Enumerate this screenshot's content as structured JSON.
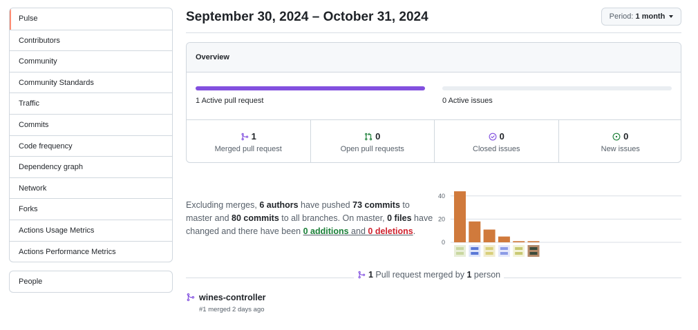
{
  "sidebar": {
    "items": [
      {
        "label": "Pulse"
      },
      {
        "label": "Contributors"
      },
      {
        "label": "Community"
      },
      {
        "label": "Community Standards"
      },
      {
        "label": "Traffic"
      },
      {
        "label": "Commits"
      },
      {
        "label": "Code frequency"
      },
      {
        "label": "Dependency graph"
      },
      {
        "label": "Network"
      },
      {
        "label": "Forks"
      },
      {
        "label": "Actions Usage Metrics"
      },
      {
        "label": "Actions Performance Metrics"
      }
    ],
    "selected": "Pulse",
    "secondary": {
      "label": "People"
    }
  },
  "header": {
    "title": "September 30, 2024 – October 31, 2024",
    "period_label": "Period:",
    "period_value": "1 month"
  },
  "overview": {
    "title": "Overview",
    "pull_requests_label": "1 Active pull request",
    "pull_requests_fill": 1.0,
    "issues_label": "0 Active issues",
    "issues_fill": 0.0,
    "stats": [
      {
        "icon": "merged-icon",
        "value": "1",
        "label": "Merged pull request",
        "color": "#8250df"
      },
      {
        "icon": "open-pr-icon",
        "value": "0",
        "label": "Open pull requests",
        "color": "#1a7f37"
      },
      {
        "icon": "closed-issue-icon",
        "value": "0",
        "label": "Closed issues",
        "color": "#8250df"
      },
      {
        "icon": "open-issue-icon",
        "value": "0",
        "label": "New issues",
        "color": "#1a7f37"
      }
    ]
  },
  "summary": {
    "t1": "Excluding merges, ",
    "authors": "6 authors",
    "t2": " have pushed ",
    "commits": "73 commits",
    "t3": " to master and ",
    "commits_all": "80 commits",
    "t4": " to all branches. On master, ",
    "files": "0 files",
    "t5": " have changed and there have been ",
    "additions": "0 additions",
    "t6": " and ",
    "deletions": "0 deletions",
    "t7": "."
  },
  "chart_data": {
    "type": "bar",
    "categories": [
      "author-1",
      "author-2",
      "author-3",
      "author-4",
      "author-5",
      "author-6"
    ],
    "values": [
      44,
      18,
      11,
      5,
      1,
      1
    ],
    "ylim": [
      0,
      50
    ],
    "ticks": [
      0,
      20,
      40
    ],
    "grid": true,
    "color": "#d07a3c"
  },
  "pr_section": {
    "heading_count": "1",
    "heading_mid": " Pull request merged by ",
    "heading_persons": "1",
    "heading_tail": " person",
    "item_title": "wines-controller",
    "item_meta": "#1 merged 2 days ago"
  },
  "colors": {
    "accent_purple": "#8250df",
    "accent_green": "#1a7f37",
    "selected_marker": "#fd8c73",
    "bar": "#d07a3c"
  }
}
